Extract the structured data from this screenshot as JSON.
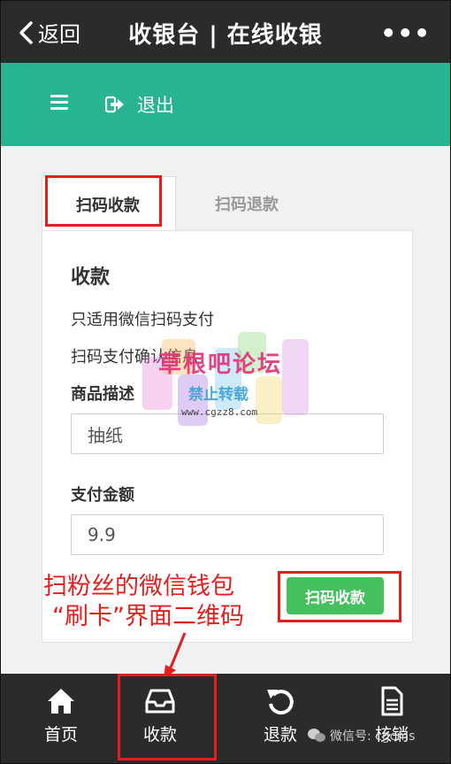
{
  "topbar": {
    "back_label": "返回",
    "title": "收银台 | 在线收银",
    "more_label": "•••"
  },
  "nav": {
    "logout_label": "退出"
  },
  "tabs": {
    "active": "扫码收款",
    "inactive": "扫码退款"
  },
  "form": {
    "section_title": "收款",
    "info_line1": "只适用微信扫码支付",
    "info_line2": "扫码支付确认信息",
    "desc_label": "商品描述",
    "desc_value": "抽纸",
    "amount_label": "支付金额",
    "amount_value": "9.9",
    "submit_label": "扫码收款"
  },
  "annotation": {
    "line1": "扫粉丝的微信钱包",
    "line2": "“刷卡”界面二维码"
  },
  "watermark": {
    "title": "草根吧论坛",
    "subtitle": "禁止转载",
    "url": "www.cgzz8.com"
  },
  "bottom_nav": [
    {
      "label": "首页",
      "icon": "home-icon"
    },
    {
      "label": "收款",
      "icon": "inbox-icon"
    },
    {
      "label": "退款",
      "icon": "undo-icon"
    },
    {
      "label": "核销",
      "icon": "document-icon"
    }
  ],
  "wechat_watermark": "微信号: cgcms",
  "colors": {
    "topbar": "#2b2b2b",
    "nav": "#28b492",
    "button": "#44c15e",
    "annotation": "#e21e1e"
  }
}
